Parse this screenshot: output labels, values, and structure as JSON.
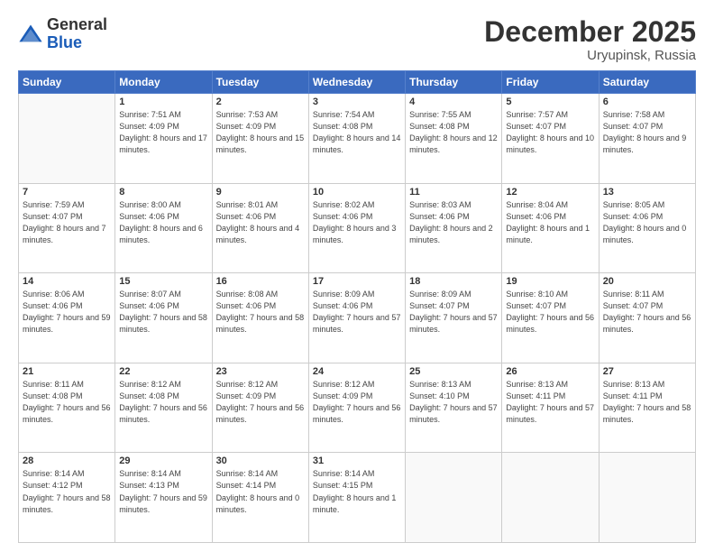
{
  "logo": {
    "general": "General",
    "blue": "Blue"
  },
  "header": {
    "month": "December 2025",
    "location": "Uryupinsk, Russia"
  },
  "weekdays": [
    "Sunday",
    "Monday",
    "Tuesday",
    "Wednesday",
    "Thursday",
    "Friday",
    "Saturday"
  ],
  "weeks": [
    [
      {
        "day": "",
        "sunrise": "",
        "sunset": "",
        "daylight": ""
      },
      {
        "day": "1",
        "sunrise": "Sunrise: 7:51 AM",
        "sunset": "Sunset: 4:09 PM",
        "daylight": "Daylight: 8 hours and 17 minutes."
      },
      {
        "day": "2",
        "sunrise": "Sunrise: 7:53 AM",
        "sunset": "Sunset: 4:09 PM",
        "daylight": "Daylight: 8 hours and 15 minutes."
      },
      {
        "day": "3",
        "sunrise": "Sunrise: 7:54 AM",
        "sunset": "Sunset: 4:08 PM",
        "daylight": "Daylight: 8 hours and 14 minutes."
      },
      {
        "day": "4",
        "sunrise": "Sunrise: 7:55 AM",
        "sunset": "Sunset: 4:08 PM",
        "daylight": "Daylight: 8 hours and 12 minutes."
      },
      {
        "day": "5",
        "sunrise": "Sunrise: 7:57 AM",
        "sunset": "Sunset: 4:07 PM",
        "daylight": "Daylight: 8 hours and 10 minutes."
      },
      {
        "day": "6",
        "sunrise": "Sunrise: 7:58 AM",
        "sunset": "Sunset: 4:07 PM",
        "daylight": "Daylight: 8 hours and 9 minutes."
      }
    ],
    [
      {
        "day": "7",
        "sunrise": "Sunrise: 7:59 AM",
        "sunset": "Sunset: 4:07 PM",
        "daylight": "Daylight: 8 hours and 7 minutes."
      },
      {
        "day": "8",
        "sunrise": "Sunrise: 8:00 AM",
        "sunset": "Sunset: 4:06 PM",
        "daylight": "Daylight: 8 hours and 6 minutes."
      },
      {
        "day": "9",
        "sunrise": "Sunrise: 8:01 AM",
        "sunset": "Sunset: 4:06 PM",
        "daylight": "Daylight: 8 hours and 4 minutes."
      },
      {
        "day": "10",
        "sunrise": "Sunrise: 8:02 AM",
        "sunset": "Sunset: 4:06 PM",
        "daylight": "Daylight: 8 hours and 3 minutes."
      },
      {
        "day": "11",
        "sunrise": "Sunrise: 8:03 AM",
        "sunset": "Sunset: 4:06 PM",
        "daylight": "Daylight: 8 hours and 2 minutes."
      },
      {
        "day": "12",
        "sunrise": "Sunrise: 8:04 AM",
        "sunset": "Sunset: 4:06 PM",
        "daylight": "Daylight: 8 hours and 1 minute."
      },
      {
        "day": "13",
        "sunrise": "Sunrise: 8:05 AM",
        "sunset": "Sunset: 4:06 PM",
        "daylight": "Daylight: 8 hours and 0 minutes."
      }
    ],
    [
      {
        "day": "14",
        "sunrise": "Sunrise: 8:06 AM",
        "sunset": "Sunset: 4:06 PM",
        "daylight": "Daylight: 7 hours and 59 minutes."
      },
      {
        "day": "15",
        "sunrise": "Sunrise: 8:07 AM",
        "sunset": "Sunset: 4:06 PM",
        "daylight": "Daylight: 7 hours and 58 minutes."
      },
      {
        "day": "16",
        "sunrise": "Sunrise: 8:08 AM",
        "sunset": "Sunset: 4:06 PM",
        "daylight": "Daylight: 7 hours and 58 minutes."
      },
      {
        "day": "17",
        "sunrise": "Sunrise: 8:09 AM",
        "sunset": "Sunset: 4:06 PM",
        "daylight": "Daylight: 7 hours and 57 minutes."
      },
      {
        "day": "18",
        "sunrise": "Sunrise: 8:09 AM",
        "sunset": "Sunset: 4:07 PM",
        "daylight": "Daylight: 7 hours and 57 minutes."
      },
      {
        "day": "19",
        "sunrise": "Sunrise: 8:10 AM",
        "sunset": "Sunset: 4:07 PM",
        "daylight": "Daylight: 7 hours and 56 minutes."
      },
      {
        "day": "20",
        "sunrise": "Sunrise: 8:11 AM",
        "sunset": "Sunset: 4:07 PM",
        "daylight": "Daylight: 7 hours and 56 minutes."
      }
    ],
    [
      {
        "day": "21",
        "sunrise": "Sunrise: 8:11 AM",
        "sunset": "Sunset: 4:08 PM",
        "daylight": "Daylight: 7 hours and 56 minutes."
      },
      {
        "day": "22",
        "sunrise": "Sunrise: 8:12 AM",
        "sunset": "Sunset: 4:08 PM",
        "daylight": "Daylight: 7 hours and 56 minutes."
      },
      {
        "day": "23",
        "sunrise": "Sunrise: 8:12 AM",
        "sunset": "Sunset: 4:09 PM",
        "daylight": "Daylight: 7 hours and 56 minutes."
      },
      {
        "day": "24",
        "sunrise": "Sunrise: 8:12 AM",
        "sunset": "Sunset: 4:09 PM",
        "daylight": "Daylight: 7 hours and 56 minutes."
      },
      {
        "day": "25",
        "sunrise": "Sunrise: 8:13 AM",
        "sunset": "Sunset: 4:10 PM",
        "daylight": "Daylight: 7 hours and 57 minutes."
      },
      {
        "day": "26",
        "sunrise": "Sunrise: 8:13 AM",
        "sunset": "Sunset: 4:11 PM",
        "daylight": "Daylight: 7 hours and 57 minutes."
      },
      {
        "day": "27",
        "sunrise": "Sunrise: 8:13 AM",
        "sunset": "Sunset: 4:11 PM",
        "daylight": "Daylight: 7 hours and 58 minutes."
      }
    ],
    [
      {
        "day": "28",
        "sunrise": "Sunrise: 8:14 AM",
        "sunset": "Sunset: 4:12 PM",
        "daylight": "Daylight: 7 hours and 58 minutes."
      },
      {
        "day": "29",
        "sunrise": "Sunrise: 8:14 AM",
        "sunset": "Sunset: 4:13 PM",
        "daylight": "Daylight: 7 hours and 59 minutes."
      },
      {
        "day": "30",
        "sunrise": "Sunrise: 8:14 AM",
        "sunset": "Sunset: 4:14 PM",
        "daylight": "Daylight: 8 hours and 0 minutes."
      },
      {
        "day": "31",
        "sunrise": "Sunrise: 8:14 AM",
        "sunset": "Sunset: 4:15 PM",
        "daylight": "Daylight: 8 hours and 1 minute."
      },
      {
        "day": "",
        "sunrise": "",
        "sunset": "",
        "daylight": ""
      },
      {
        "day": "",
        "sunrise": "",
        "sunset": "",
        "daylight": ""
      },
      {
        "day": "",
        "sunrise": "",
        "sunset": "",
        "daylight": ""
      }
    ]
  ]
}
